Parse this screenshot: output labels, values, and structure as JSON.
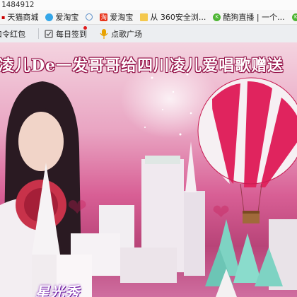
{
  "browser": {
    "address_text": "1484912",
    "bookmarks": [
      {
        "label": "天猫商城",
        "icon": "tmall-icon"
      },
      {
        "label": "爱淘宝",
        "icon": "taobao-icon"
      },
      {
        "label": "爱淘宝",
        "icon": "taobao-icon"
      },
      {
        "label": "从 360安全浏...",
        "icon": "folder-icon"
      },
      {
        "label": "酷狗直播 | 一个...",
        "icon": "kugou-icon"
      }
    ]
  },
  "toolbar": {
    "items": [
      {
        "label": "口令红包",
        "icon": "redpacket-icon"
      },
      {
        "label": "每日签到",
        "icon": "checkin-icon"
      },
      {
        "label": "点歌广场",
        "icon": "microphone-icon"
      }
    ]
  },
  "stage": {
    "banner_text": "凌儿De一发哥哥给四川凌儿爱唱歌赠送",
    "logo_text": "星光秀",
    "colors": {
      "banner_outline": "#8b0c40",
      "balloon_red": "#e0245e",
      "balloon_white": "#f6f0f3"
    }
  }
}
